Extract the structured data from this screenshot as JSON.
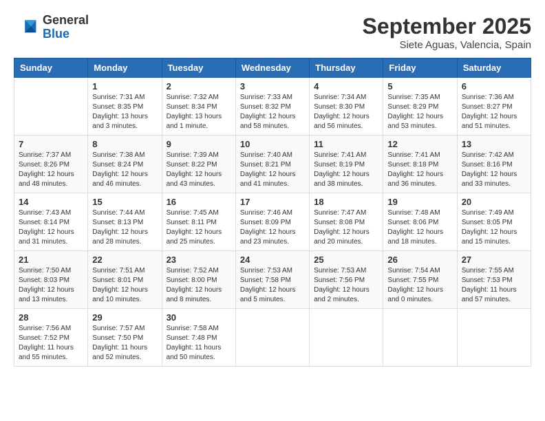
{
  "logo": {
    "general": "General",
    "blue": "Blue"
  },
  "title": "September 2025",
  "subtitle": "Siete Aguas, Valencia, Spain",
  "days_of_week": [
    "Sunday",
    "Monday",
    "Tuesday",
    "Wednesday",
    "Thursday",
    "Friday",
    "Saturday"
  ],
  "weeks": [
    [
      {
        "day": "",
        "info": ""
      },
      {
        "day": "1",
        "info": "Sunrise: 7:31 AM\nSunset: 8:35 PM\nDaylight: 13 hours\nand 3 minutes."
      },
      {
        "day": "2",
        "info": "Sunrise: 7:32 AM\nSunset: 8:34 PM\nDaylight: 13 hours\nand 1 minute."
      },
      {
        "day": "3",
        "info": "Sunrise: 7:33 AM\nSunset: 8:32 PM\nDaylight: 12 hours\nand 58 minutes."
      },
      {
        "day": "4",
        "info": "Sunrise: 7:34 AM\nSunset: 8:30 PM\nDaylight: 12 hours\nand 56 minutes."
      },
      {
        "day": "5",
        "info": "Sunrise: 7:35 AM\nSunset: 8:29 PM\nDaylight: 12 hours\nand 53 minutes."
      },
      {
        "day": "6",
        "info": "Sunrise: 7:36 AM\nSunset: 8:27 PM\nDaylight: 12 hours\nand 51 minutes."
      }
    ],
    [
      {
        "day": "7",
        "info": "Sunrise: 7:37 AM\nSunset: 8:26 PM\nDaylight: 12 hours\nand 48 minutes."
      },
      {
        "day": "8",
        "info": "Sunrise: 7:38 AM\nSunset: 8:24 PM\nDaylight: 12 hours\nand 46 minutes."
      },
      {
        "day": "9",
        "info": "Sunrise: 7:39 AM\nSunset: 8:22 PM\nDaylight: 12 hours\nand 43 minutes."
      },
      {
        "day": "10",
        "info": "Sunrise: 7:40 AM\nSunset: 8:21 PM\nDaylight: 12 hours\nand 41 minutes."
      },
      {
        "day": "11",
        "info": "Sunrise: 7:41 AM\nSunset: 8:19 PM\nDaylight: 12 hours\nand 38 minutes."
      },
      {
        "day": "12",
        "info": "Sunrise: 7:41 AM\nSunset: 8:18 PM\nDaylight: 12 hours\nand 36 minutes."
      },
      {
        "day": "13",
        "info": "Sunrise: 7:42 AM\nSunset: 8:16 PM\nDaylight: 12 hours\nand 33 minutes."
      }
    ],
    [
      {
        "day": "14",
        "info": "Sunrise: 7:43 AM\nSunset: 8:14 PM\nDaylight: 12 hours\nand 31 minutes."
      },
      {
        "day": "15",
        "info": "Sunrise: 7:44 AM\nSunset: 8:13 PM\nDaylight: 12 hours\nand 28 minutes."
      },
      {
        "day": "16",
        "info": "Sunrise: 7:45 AM\nSunset: 8:11 PM\nDaylight: 12 hours\nand 25 minutes."
      },
      {
        "day": "17",
        "info": "Sunrise: 7:46 AM\nSunset: 8:09 PM\nDaylight: 12 hours\nand 23 minutes."
      },
      {
        "day": "18",
        "info": "Sunrise: 7:47 AM\nSunset: 8:08 PM\nDaylight: 12 hours\nand 20 minutes."
      },
      {
        "day": "19",
        "info": "Sunrise: 7:48 AM\nSunset: 8:06 PM\nDaylight: 12 hours\nand 18 minutes."
      },
      {
        "day": "20",
        "info": "Sunrise: 7:49 AM\nSunset: 8:05 PM\nDaylight: 12 hours\nand 15 minutes."
      }
    ],
    [
      {
        "day": "21",
        "info": "Sunrise: 7:50 AM\nSunset: 8:03 PM\nDaylight: 12 hours\nand 13 minutes."
      },
      {
        "day": "22",
        "info": "Sunrise: 7:51 AM\nSunset: 8:01 PM\nDaylight: 12 hours\nand 10 minutes."
      },
      {
        "day": "23",
        "info": "Sunrise: 7:52 AM\nSunset: 8:00 PM\nDaylight: 12 hours\nand 8 minutes."
      },
      {
        "day": "24",
        "info": "Sunrise: 7:53 AM\nSunset: 7:58 PM\nDaylight: 12 hours\nand 5 minutes."
      },
      {
        "day": "25",
        "info": "Sunrise: 7:53 AM\nSunset: 7:56 PM\nDaylight: 12 hours\nand 2 minutes."
      },
      {
        "day": "26",
        "info": "Sunrise: 7:54 AM\nSunset: 7:55 PM\nDaylight: 12 hours\nand 0 minutes."
      },
      {
        "day": "27",
        "info": "Sunrise: 7:55 AM\nSunset: 7:53 PM\nDaylight: 11 hours\nand 57 minutes."
      }
    ],
    [
      {
        "day": "28",
        "info": "Sunrise: 7:56 AM\nSunset: 7:52 PM\nDaylight: 11 hours\nand 55 minutes."
      },
      {
        "day": "29",
        "info": "Sunrise: 7:57 AM\nSunset: 7:50 PM\nDaylight: 11 hours\nand 52 minutes."
      },
      {
        "day": "30",
        "info": "Sunrise: 7:58 AM\nSunset: 7:48 PM\nDaylight: 11 hours\nand 50 minutes."
      },
      {
        "day": "",
        "info": ""
      },
      {
        "day": "",
        "info": ""
      },
      {
        "day": "",
        "info": ""
      },
      {
        "day": "",
        "info": ""
      }
    ]
  ]
}
